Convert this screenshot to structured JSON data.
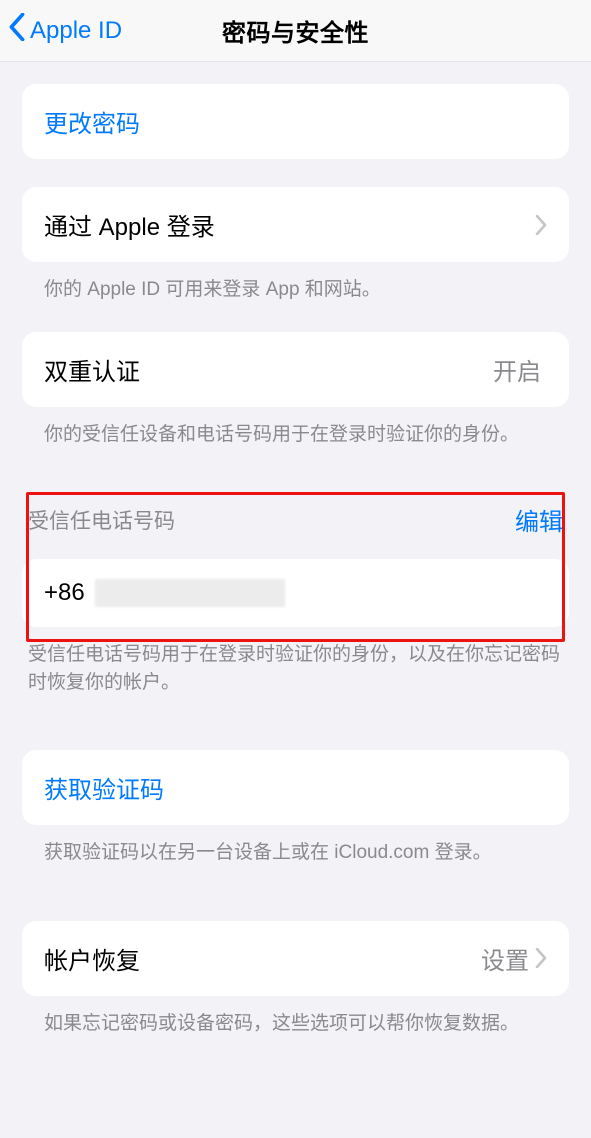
{
  "nav": {
    "back_label": "Apple ID",
    "title": "密码与安全性"
  },
  "change_password": {
    "label": "更改密码"
  },
  "sign_in_with_apple": {
    "label": "通过 Apple 登录",
    "footer": "你的 Apple ID 可用来登录 App 和网站。"
  },
  "two_factor": {
    "label": "双重认证",
    "value": "开启",
    "footer": "你的受信任设备和电话号码用于在登录时验证你的身份。"
  },
  "trusted_phone": {
    "header": "受信任电话号码",
    "edit": "编辑",
    "prefix": "+86",
    "footer": "受信任电话号码用于在登录时验证你的身份，以及在你忘记密码时恢复你的帐户。"
  },
  "get_code": {
    "label": "获取验证码",
    "footer": "获取验证码以在另一台设备上或在 iCloud.com 登录。"
  },
  "account_recovery": {
    "label": "帐户恢复",
    "value": "设置",
    "footer": "如果忘记密码或设备密码，这些选项可以帮你恢复数据。"
  }
}
